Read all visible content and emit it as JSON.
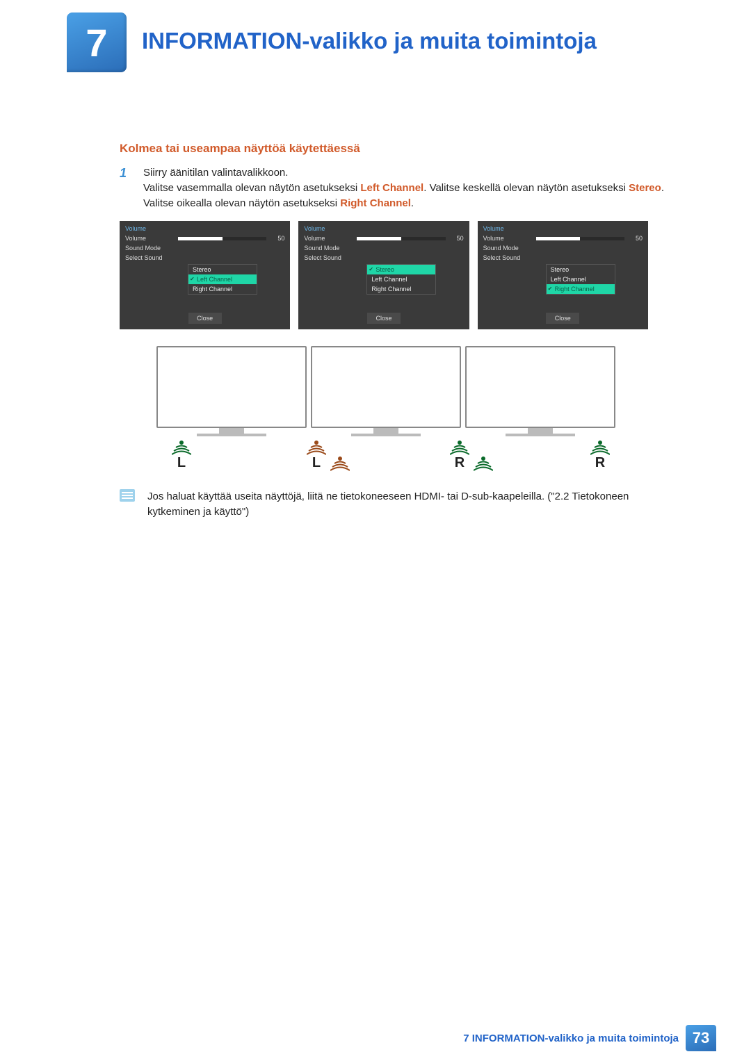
{
  "header": {
    "chapter_number": "7",
    "page_title": "INFORMATION-valikko ja muita toimintoja"
  },
  "section_title": "Kolmea tai useampaa näyttöä käytettäessä",
  "step": {
    "number": "1",
    "line1": "Siirry äänitilan valintavalikkoon.",
    "line2a": "Valitse vasemmalla olevan näytön asetukseksi ",
    "kw_left": "Left Channel",
    "line2b": ". Valitse keskellä olevan näytön asetukseksi ",
    "kw_stereo": "Stereo",
    "line2c": ". Valitse oikealla olevan näytön asetukseksi ",
    "kw_right": "Right Channel",
    "line2d": "."
  },
  "osd": {
    "title": "Volume",
    "volume_label": "Volume",
    "volume_value": "50",
    "sound_mode_label": "Sound Mode",
    "select_sound_label": "Select Sound",
    "options": {
      "stereo": "Stereo",
      "left": "Left Channel",
      "right": "Right Channel"
    },
    "close": "Close",
    "panels": [
      {
        "selected": "left"
      },
      {
        "selected": "stereo"
      },
      {
        "selected": "right"
      }
    ]
  },
  "speakers": {
    "labels": [
      "L",
      "L",
      "R",
      "R"
    ]
  },
  "note": "Jos haluat käyttää useita näyttöjä, liitä ne tietokoneeseen HDMI- tai D-sub-kaapeleilla. (\"2.2 Tietokoneen kytkeminen ja käyttö\")",
  "footer": {
    "title": "7 INFORMATION-valikko ja muita toimintoja",
    "page": "73"
  }
}
